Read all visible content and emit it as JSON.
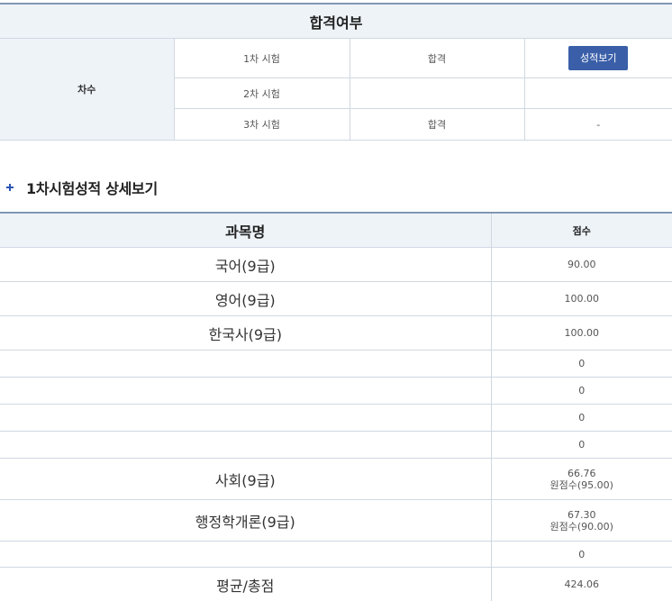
{
  "result": {
    "header": "합격여부",
    "round_label": "차수",
    "rounds": [
      {
        "name": "1차 시험",
        "status": "합격",
        "action": "성적보기"
      },
      {
        "name": "2차 시험",
        "status": "",
        "action": ""
      },
      {
        "name": "3차 시험",
        "status": "합격",
        "action": "-"
      }
    ]
  },
  "detail": {
    "icon": "plus-icon",
    "title": "1차시험성적 상세보기"
  },
  "scores": {
    "headers": {
      "subject": "과목명",
      "score": "점수"
    },
    "rows": [
      {
        "subject": "국어(9급)",
        "score": "90.00",
        "raw": ""
      },
      {
        "subject": "영어(9급)",
        "score": "100.00",
        "raw": ""
      },
      {
        "subject": "한국사(9급)",
        "score": "100.00",
        "raw": ""
      },
      {
        "subject": "",
        "score": "0",
        "raw": ""
      },
      {
        "subject": "",
        "score": "0",
        "raw": ""
      },
      {
        "subject": "",
        "score": "0",
        "raw": ""
      },
      {
        "subject": "",
        "score": "0",
        "raw": ""
      },
      {
        "subject": "사회(9급)",
        "score": "66.76",
        "raw": "원점수(95.00)"
      },
      {
        "subject": "행정학개론(9급)",
        "score": "67.30",
        "raw": "원점수(90.00)"
      },
      {
        "subject": "",
        "score": "0",
        "raw": ""
      }
    ],
    "total": {
      "subject": "평균/총점",
      "score": "424.06"
    }
  },
  "colors": {
    "header_bg": "#eef3f8",
    "border": "#cfd8e2",
    "top_border": "#7f97b2",
    "button": "#3a5fa8",
    "plus_icon": "#2b54b3"
  }
}
